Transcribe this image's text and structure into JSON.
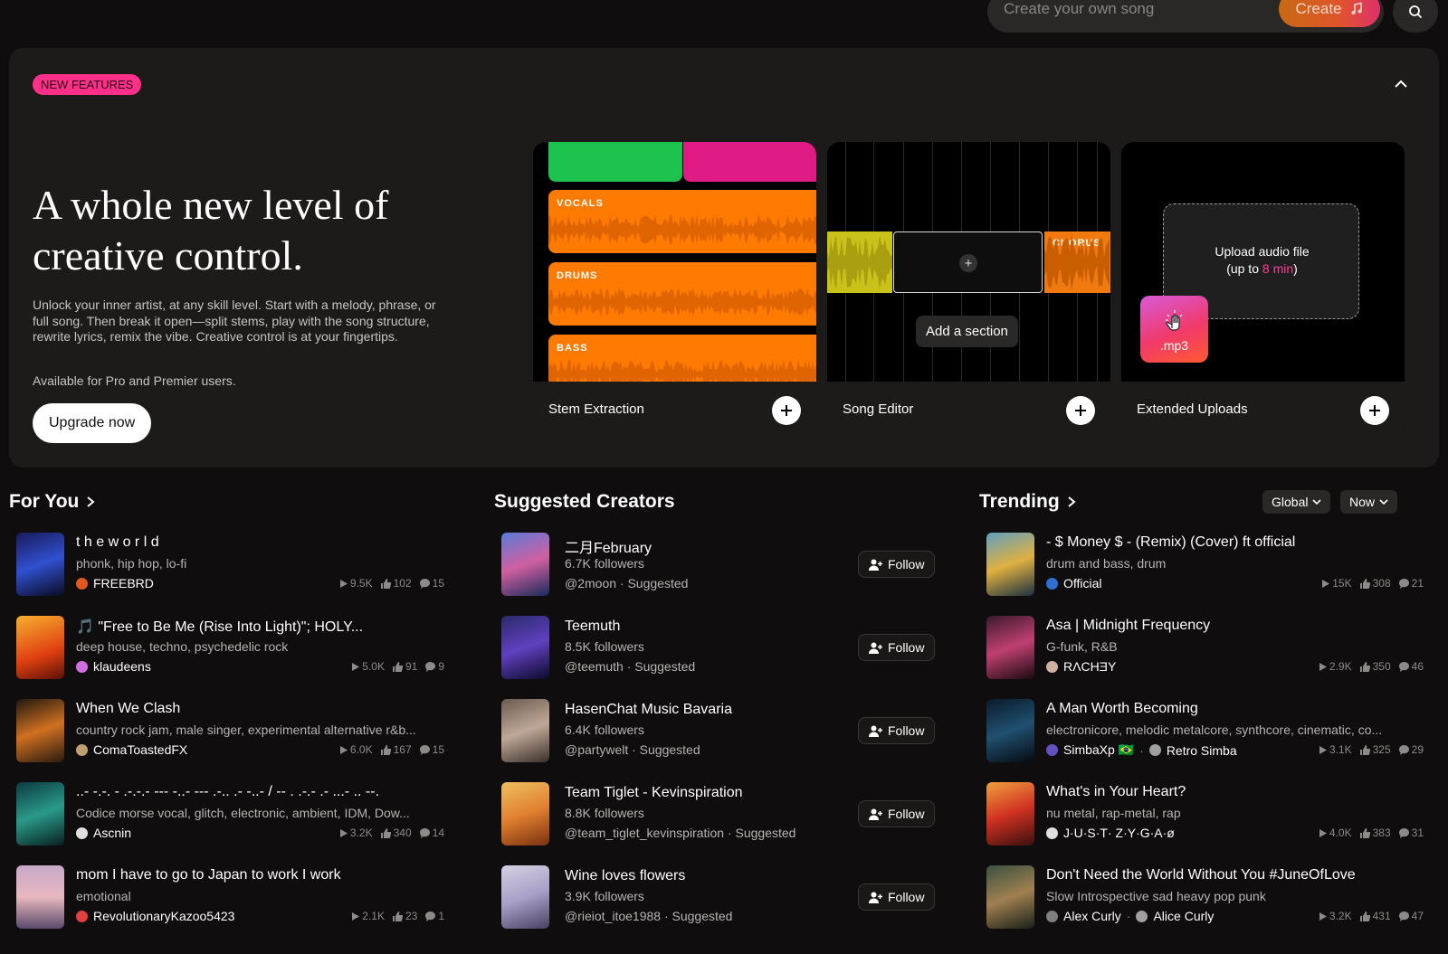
{
  "topbar": {
    "create_placeholder": "Create your own song",
    "create_label": "Create"
  },
  "hero": {
    "badge": "NEW FEATURES",
    "title": "A whole new level of creative control.",
    "description": "Unlock your inner artist, at any skill level. Start with a melody, phrase, or full song. Then break it open—split stems, play with the song structure, rewrite lyrics, remix the vibe. Creative control is at your fingertips.",
    "availability": "Available for Pro and Premier users.",
    "upgrade_label": "Upgrade now",
    "cards": [
      {
        "label": "Stem Extraction",
        "stems": [
          "VOCALS",
          "DRUMS",
          "BASS"
        ]
      },
      {
        "label": "Song Editor",
        "segment_label": "CHORUS",
        "add_section": "Add a section"
      },
      {
        "label": "Extended Uploads",
        "upload_line1": "Upload audio file",
        "upload_line2_pre": "(up to ",
        "upload_line2_hl": "8 min",
        "upload_line2_post": ")",
        "file_ext": ".mp3"
      }
    ]
  },
  "for_you": {
    "title": "For You",
    "items": [
      {
        "title": "t h e w o r l d",
        "genres": "phonk, hip hop, lo-fi",
        "user": "FREEBRD",
        "plays": "9.5K",
        "likes": "102",
        "comments": "15"
      },
      {
        "title": "🎵 \"Free to Be Me (Rise Into Light)\"; HOLY...",
        "genres": "deep house, techno, psychedelic rock",
        "user": "klaudeens",
        "plays": "5.0K",
        "likes": "91",
        "comments": "9"
      },
      {
        "title": "When We Clash",
        "genres": "country rock jam, male singer, experimental alternative r&b...",
        "user": "ComaToastedFX",
        "plays": "6.0K",
        "likes": "167",
        "comments": "15"
      },
      {
        "title": "..- -.-. - .-.-.- --- -..- --- .-.. .- -..- / -- . .-.- .- ...- .. --. .-. .. .. ...",
        "genres": "Codice morse vocal, glitch, electronic, ambient, IDM, Dow...",
        "user": "Ascnin",
        "plays": "3.2K",
        "likes": "340",
        "comments": "14"
      },
      {
        "title": "mom I have to go to Japan to work I work",
        "genres": "emotional",
        "user": "RevolutionaryKazoo5423",
        "plays": "2.1K",
        "likes": "23",
        "comments": "1"
      }
    ]
  },
  "creators": {
    "title": "Suggested Creators",
    "follow_label": "Follow",
    "items": [
      {
        "name": "二月February",
        "followers": "6.7K followers",
        "handle": "@2moon · Suggested"
      },
      {
        "name": "Teemuth",
        "followers": "8.5K followers",
        "handle": "@teemuth · Suggested"
      },
      {
        "name": "HasenChat Music Bavaria",
        "followers": "6.4K followers",
        "handle": "@partywelt · Suggested"
      },
      {
        "name": "Team Tiglet - Kevinspiration",
        "followers": "8.8K followers",
        "handle": "@team_tiglet_kevinspiration · Suggested"
      },
      {
        "name": "Wine loves flowers",
        "followers": "3.9K followers",
        "handle": "@rieiot_itoe1988 · Suggested"
      }
    ]
  },
  "trending": {
    "title": "Trending",
    "filter_region": "Global",
    "filter_time": "Now",
    "items": [
      {
        "title": "- $ Money $ - (Remix) (Cover) ft official",
        "genres": "drum and bass, drum",
        "user": "Official",
        "user2": "",
        "plays": "15K",
        "likes": "308",
        "comments": "21"
      },
      {
        "title": "Asa | Midnight Frequency",
        "genres": "G-funk, R&B",
        "user": "RΛCHƎY",
        "user2": "",
        "plays": "2.9K",
        "likes": "350",
        "comments": "46"
      },
      {
        "title": "A Man Worth Becoming",
        "genres": "electronicore, melodic metalcore, synthcore, cinematic, co...",
        "user": "SimbaXp 🇧🇷",
        "user2": "Retro Simba",
        "plays": "3.1K",
        "likes": "325",
        "comments": "29"
      },
      {
        "title": "What's in Your Heart?",
        "genres": "nu metal, rap-metal, rap",
        "user": "J·U·S·T· Z·Y·G·A·ø",
        "user2": "",
        "plays": "4.0K",
        "likes": "383",
        "comments": "31"
      },
      {
        "title": "Don't Need the World Without You #JuneOfLove",
        "genres": "Slow Introspective sad heavy pop punk",
        "user": "Alex Curly",
        "user2": "Alice Curly",
        "plays": "3.2K",
        "likes": "431",
        "comments": "47"
      }
    ]
  }
}
